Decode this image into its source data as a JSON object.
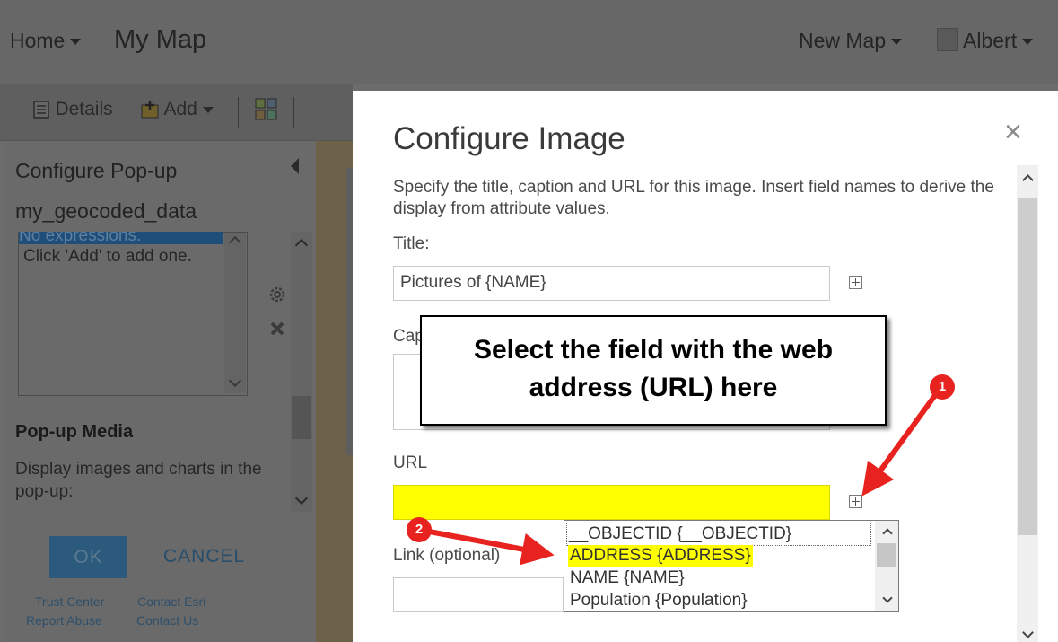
{
  "header": {
    "home_label": "Home",
    "map_title": "My Map",
    "new_map_label": "New Map",
    "user_name": "Albert"
  },
  "toolbar": {
    "details_label": "Details",
    "add_label": "Add"
  },
  "left_panel": {
    "title": "Configure Pop-up",
    "layer_name": "my_geocoded_data",
    "expressions_selected": "No expressions.",
    "expressions_hint": "Click 'Add' to add one.",
    "media_heading": "Pop-up Media",
    "media_text": "Display images and charts in the pop-up:",
    "ok_label": "OK",
    "cancel_label": "CANCEL",
    "footer": {
      "trust_center": "Trust Center",
      "contact_esri": "Contact Esri",
      "report_abuse": "Report Abuse",
      "contact_us": "Contact Us"
    }
  },
  "modal": {
    "title": "Configure Image",
    "close_glyph": "×",
    "description": "Specify the title, caption and URL for this image. Insert field names to derive the display from attribute values.",
    "title_label": "Title:",
    "title_value": "Pictures of {NAME}",
    "caption_label_visible": "Cap",
    "url_label": "URL",
    "url_value": "",
    "link_label": "Link (optional)",
    "highlight_color": "#ffff00"
  },
  "dropdown": {
    "options": [
      "__OBJECTID {__OBJECTID}",
      "ADDRESS {ADDRESS}",
      "NAME {NAME}",
      "Population {Population}"
    ],
    "selected_index": 1
  },
  "annotations": {
    "callout_text": "Select the field with the web address (URL) here",
    "badge_1": "1",
    "badge_2": "2",
    "arrow_color": "#e8231f"
  }
}
